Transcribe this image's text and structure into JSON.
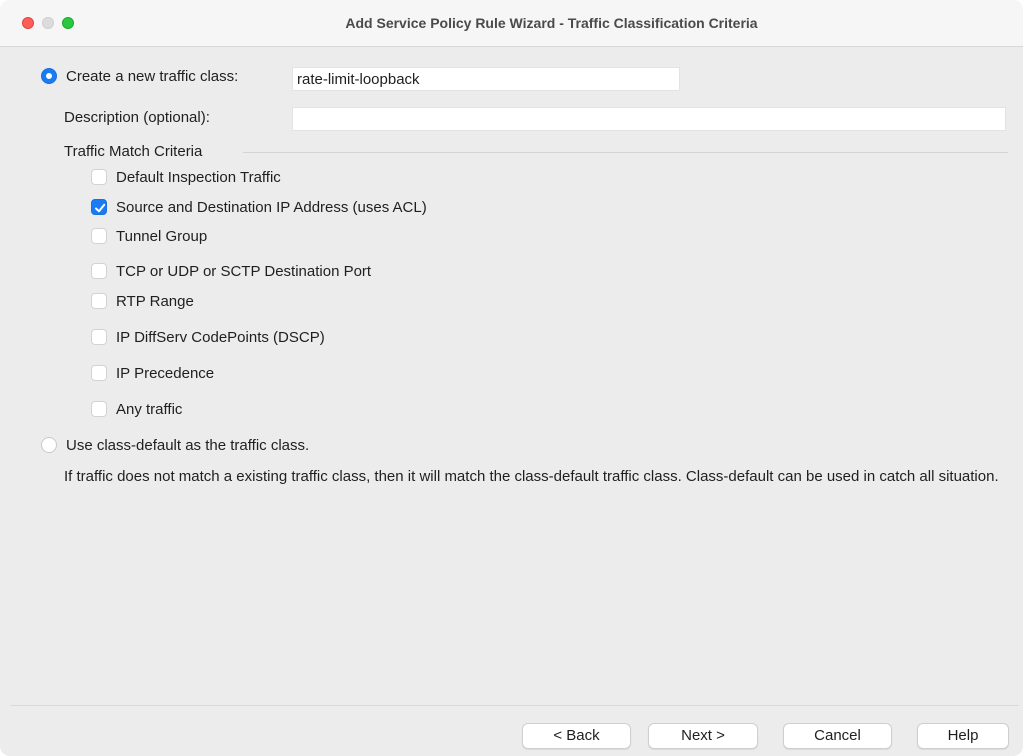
{
  "window": {
    "title": "Add Service Policy Rule Wizard - Traffic Classification Criteria"
  },
  "create_class": {
    "label": "Create a new traffic class:",
    "selected": true,
    "name_value": "rate-limit-loopback",
    "description_label": "Description (optional):",
    "description_value": ""
  },
  "criteria": {
    "group_label": "Traffic Match Criteria",
    "items": [
      {
        "label": "Default Inspection Traffic",
        "checked": false
      },
      {
        "label": "Source and Destination IP Address (uses ACL)",
        "checked": true
      },
      {
        "label": "Tunnel Group",
        "checked": false
      },
      {
        "label": "TCP or UDP or SCTP Destination Port",
        "checked": false
      },
      {
        "label": "RTP Range",
        "checked": false
      },
      {
        "label": "IP DiffServ CodePoints (DSCP)",
        "checked": false
      },
      {
        "label": "IP Precedence",
        "checked": false
      },
      {
        "label": "Any traffic",
        "checked": false
      }
    ]
  },
  "class_default": {
    "label": "Use class-default as the traffic class.",
    "selected": false,
    "note": "If traffic does not match a existing traffic class, then it will match the class-default traffic class. Class-default can be used in catch all situation."
  },
  "footer": {
    "back_label": "< Back",
    "next_label": "Next >",
    "cancel_label": "Cancel",
    "help_label": "Help"
  },
  "colors": {
    "accent": "#1a7cf5",
    "close": "#fe5f57",
    "zoom": "#28c840"
  }
}
